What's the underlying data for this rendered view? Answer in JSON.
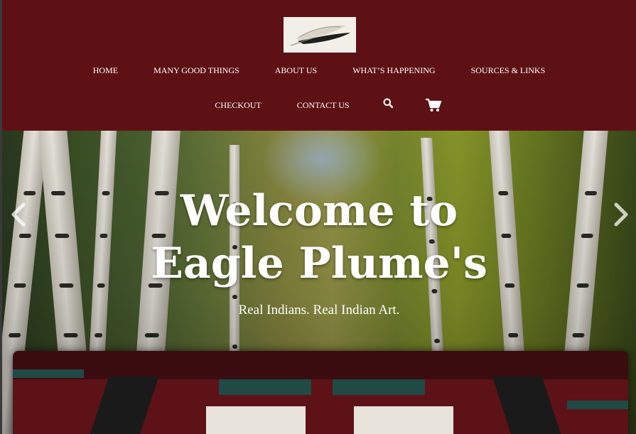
{
  "site": {
    "logo_alt": "Eagle Plume's feather logo"
  },
  "nav": {
    "primary": [
      {
        "label": "HOME"
      },
      {
        "label": "MANY GOOD THINGS"
      },
      {
        "label": "ABOUT US"
      },
      {
        "label": "WHAT’S HAPPENING"
      },
      {
        "label": "SOURCES & LINKS"
      }
    ],
    "secondary": [
      {
        "label": "CHECKOUT"
      },
      {
        "label": "CONTACT US"
      }
    ],
    "search_icon": "search-icon",
    "cart_icon": "cart-icon"
  },
  "hero": {
    "title_line1": "Welcome to",
    "title_line2": "Eagle Plume's",
    "subtitle": "Real Indians. Real Indian Art.",
    "prev_icon": "chevron-left-icon",
    "next_icon": "chevron-right-icon"
  },
  "colors": {
    "header_bg": "#5e1115",
    "text": "#ffffff",
    "rug_red": "#5c1216",
    "rug_teal": "#1f4a45"
  }
}
